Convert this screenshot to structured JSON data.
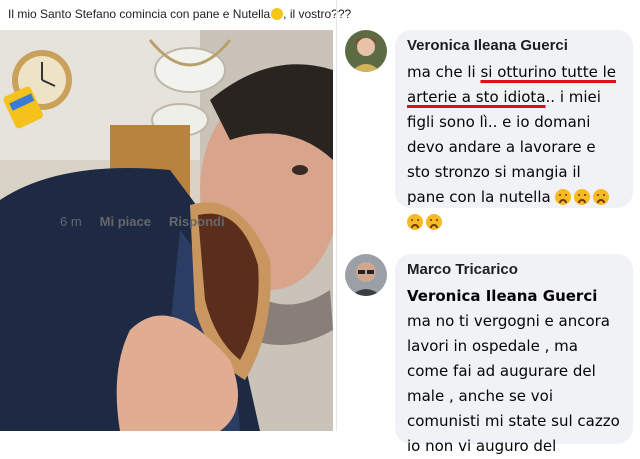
{
  "post": {
    "caption": "Il mio Santo Stefano comincia con pane e Nutella",
    "caption_suffix": ", il vostro???"
  },
  "comments": [
    {
      "author": "Veronica Ileana Guerci",
      "text_parts": [
        "ma che li ",
        "si otturino tutte le arterie a sto idiota",
        ".. i miei figli sono lì.. e io domani devo andare a lavorare e sto stronzo si mangia il pane con la nutella "
      ],
      "sad_emoji_count": 5,
      "time": "6 m",
      "like_label": "Mi piace",
      "reply_label": "Rispondi"
    },
    {
      "author": "Marco Tricarico",
      "mention": "Veronica Ileana Guerci",
      "text": " ma no ti vergogni e ancora lavori in ospedale , ma come fai ad augurare del male , anche se voi comunisti mi state sul cazzo io non vi auguro del"
    }
  ],
  "colors": {
    "underline": "#e01010",
    "bubble": "#f0f2f5",
    "meta_text": "#65676b"
  }
}
